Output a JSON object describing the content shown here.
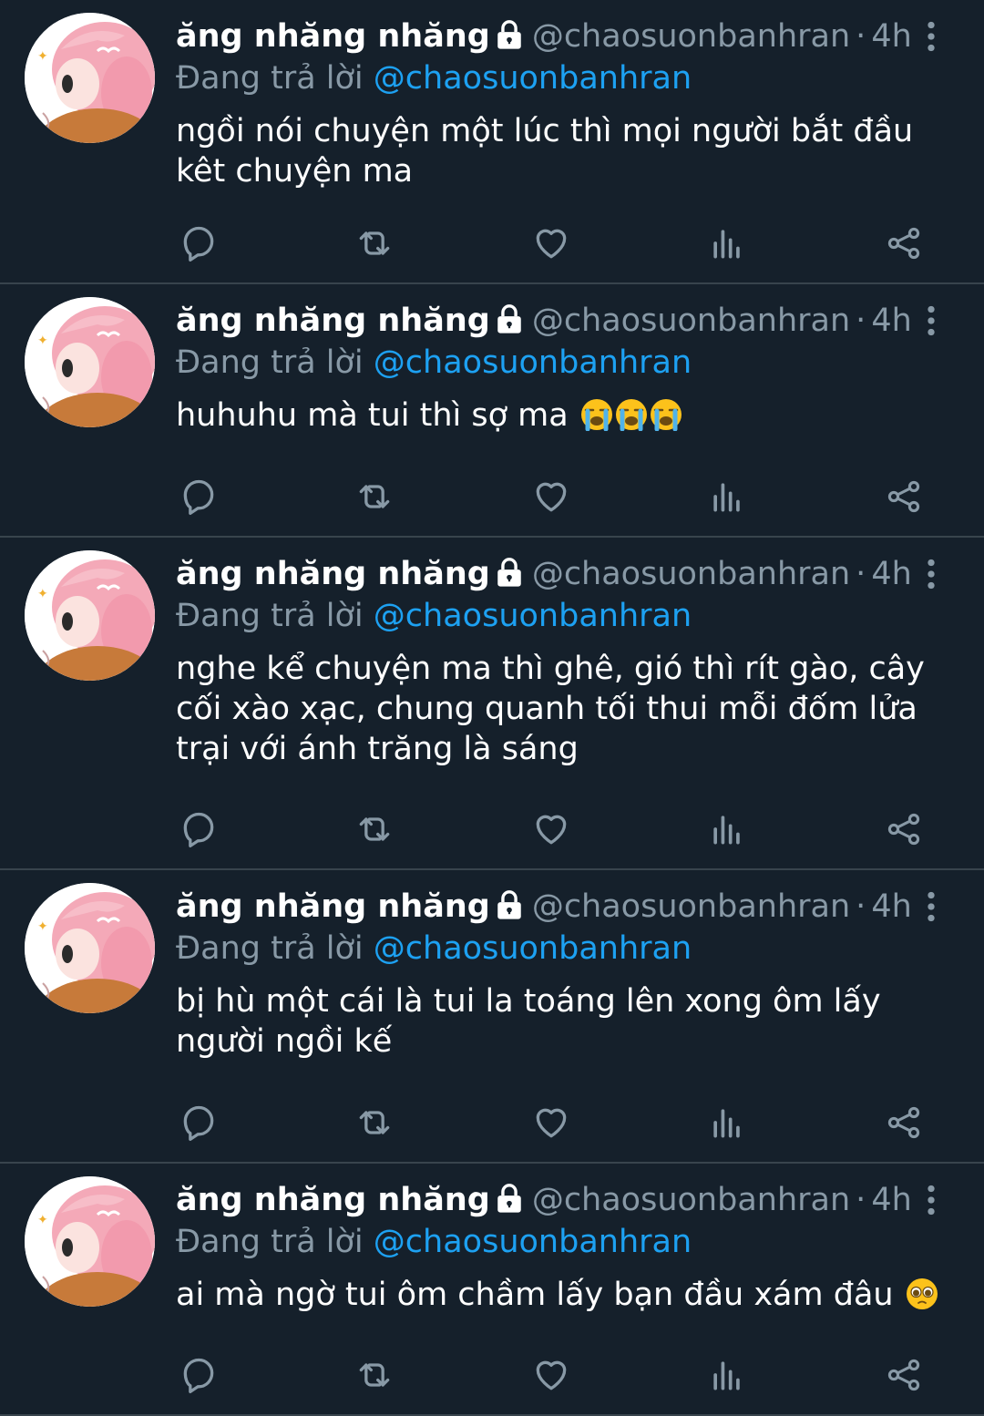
{
  "tweets": [
    {
      "name": "ăng nhăng nhăng",
      "handle": "@chaosuonbanhran",
      "separator": "·",
      "time": "4h",
      "replying_prefix": "Đang trả lời",
      "replying_to": "@chaosuonbanhran",
      "text": "ngồi nói chuyện một lúc thì mọi người bắt đầu kêt chuyện ma",
      "emojis": []
    },
    {
      "name": "ăng nhăng nhăng",
      "handle": "@chaosuonbanhran",
      "separator": "·",
      "time": "4h",
      "replying_prefix": "Đang trả lời",
      "replying_to": "@chaosuonbanhran",
      "text": "huhuhu mà tui thì sợ ma",
      "emojis": [
        "loudly-crying-face",
        "loudly-crying-face",
        "loudly-crying-face"
      ]
    },
    {
      "name": "ăng nhăng nhăng",
      "handle": "@chaosuonbanhran",
      "separator": "·",
      "time": "4h",
      "replying_prefix": "Đang trả lời",
      "replying_to": "@chaosuonbanhran",
      "text": "nghe kể chuyện ma thì ghê, gió thì rít gào, cây cối xào xạc, chung quanh tối thui mỗi đốm lửa trại với ánh trăng là sáng",
      "emojis": []
    },
    {
      "name": "ăng nhăng nhăng",
      "handle": "@chaosuonbanhran",
      "separator": "·",
      "time": "4h",
      "replying_prefix": "Đang trả lời",
      "replying_to": "@chaosuonbanhran",
      "text": "bị hù một cái là tui la toáng lên xong ôm lấy người ngồi kế",
      "emojis": []
    },
    {
      "name": "ăng nhăng nhăng",
      "handle": "@chaosuonbanhran",
      "separator": "·",
      "time": "4h",
      "replying_prefix": "Đang trả lời",
      "replying_to": "@chaosuonbanhran",
      "text": "ai mà ngờ tui ôm chầm lấy bạn đầu xám đâu",
      "emojis": [
        "pleading-face"
      ]
    }
  ],
  "icons": {
    "lock": "lock-icon",
    "more": "more-vertical-icon",
    "reply": "reply-icon",
    "retweet": "retweet-icon",
    "like": "heart-icon",
    "views": "analytics-icon",
    "share": "share-icon"
  },
  "colors": {
    "background": "#15202b",
    "divider": "#38444d",
    "secondary_text": "#8899a6",
    "link": "#1da1f2",
    "icon": "#8899a6"
  }
}
